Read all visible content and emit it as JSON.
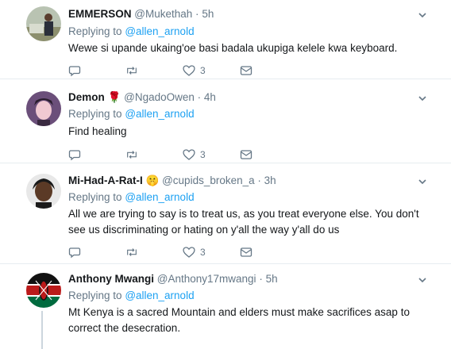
{
  "replying_prefix": "Replying to",
  "tweets": [
    {
      "name": "EMMERSON",
      "emoji": "",
      "handle": "@Mukethah",
      "time": "5h",
      "reply_to": "@allen_arnold",
      "text": "Wewe si upande ukaing'oe basi badala ukupiga kelele kwa keyboard.",
      "likes": "3"
    },
    {
      "name": "Demon",
      "emoji": "🌹",
      "handle": "@NgadoOwen",
      "time": "4h",
      "reply_to": "@allen_arnold",
      "text": "Find healing",
      "likes": "3"
    },
    {
      "name": "Mi-Had-A-Rat-I",
      "emoji": "🤫",
      "handle": "@cupids_broken_a",
      "time": "3h",
      "reply_to": "@allen_arnold",
      "text": "All we are trying to say is to treat us, as you treat everyone else. You don't see us discriminating or hating on y'all the way y'all do us",
      "likes": "3"
    },
    {
      "name": "Anthony Mwangi",
      "emoji": "",
      "handle": "@Anthony17mwangi",
      "time": "5h",
      "reply_to": "@allen_arnold",
      "text": "Mt Kenya is a sacred Mountain and elders must make sacrifices asap to correct the desecration.",
      "likes": ""
    }
  ],
  "colors": {
    "link": "#1da1f2",
    "secondary": "#657786",
    "border": "#e6ecf0"
  },
  "icons": [
    "chevron-down-icon",
    "reply-icon",
    "retweet-icon",
    "like-icon",
    "direct-message-icon"
  ]
}
